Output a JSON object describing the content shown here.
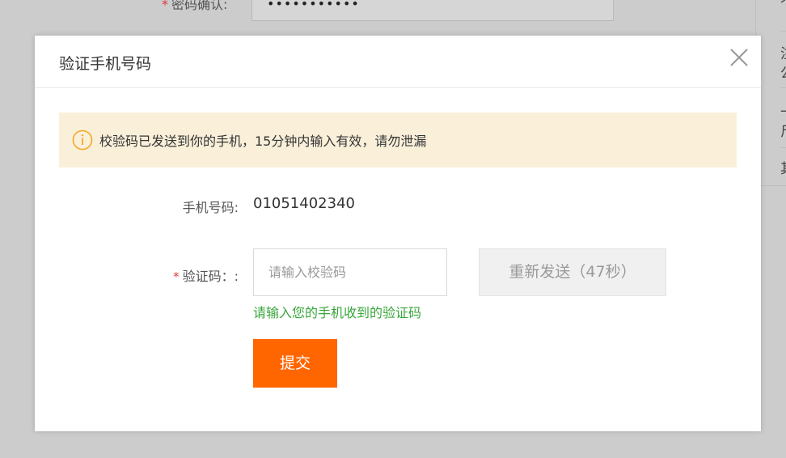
{
  "background": {
    "label": "密码确认:",
    "required_mark": "*",
    "password_mask": "•••••••••••",
    "side_text": [
      "个",
      "注",
      "公",
      "一",
      "斤",
      "其"
    ]
  },
  "modal": {
    "title": "验证手机号码",
    "close_icon": "close-icon",
    "alert": {
      "icon": "info-circle-icon",
      "text": "校验码已发送到你的手机，15分钟内输入有效，请勿泄漏",
      "background_color": "#faf0da",
      "icon_color": "#f5a623"
    },
    "phone": {
      "label": "手机号码:",
      "value": "01051402340"
    },
    "code": {
      "required_mark": "*",
      "label": "验证码：:",
      "placeholder": "请输入校验码",
      "value": ""
    },
    "resend_button": "重新发送（47秒）",
    "hint": "请输入您的手机收到的验证码",
    "submit_button": "提交",
    "colors": {
      "accent": "#ff6600",
      "hint": "#38a63a",
      "required": "#e4393c"
    }
  }
}
